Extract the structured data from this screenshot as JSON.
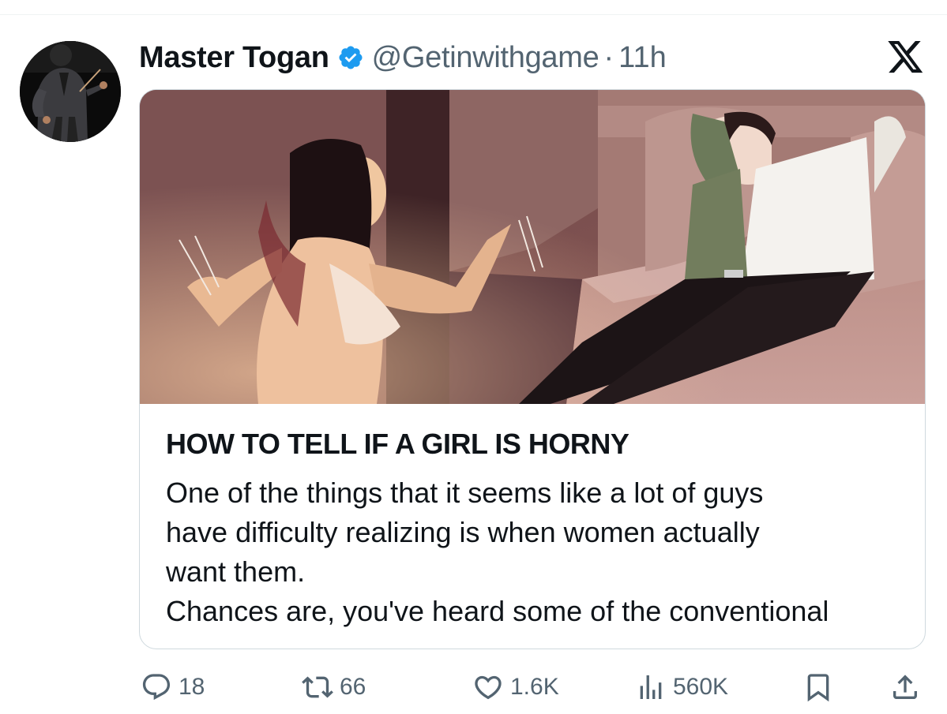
{
  "tweet": {
    "display_name": "Master Togan",
    "handle": "@Getinwithgame",
    "separator": "·",
    "time": "11h"
  },
  "card": {
    "title": "HOW TO TELL IF A GIRL IS HORNY",
    "description_lines": [
      "One of the things that it seems like a lot of guys",
      "have difficulty realizing is when women actually",
      "want them.",
      "Chances are, you've heard some of the conventional"
    ]
  },
  "actions": {
    "replies": "18",
    "reposts": "66",
    "likes": "1.6K",
    "views": "560K"
  },
  "colors": {
    "verified_badge": "#1d9bf0",
    "secondary_text": "#536471",
    "divider": "#eff3f4",
    "card_border": "#cfd9de"
  },
  "icons": {
    "brand": "x-logo-icon",
    "verified": "verified-badge-icon",
    "reply": "reply-icon",
    "repost": "repost-icon",
    "like": "heart-icon",
    "views": "views-chart-icon",
    "bookmark": "bookmark-icon",
    "share": "share-icon"
  }
}
